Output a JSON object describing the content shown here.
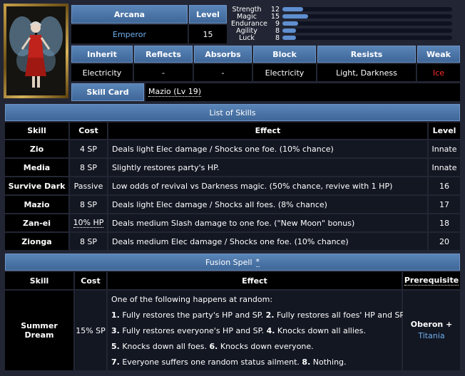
{
  "persona": {
    "arcana_label": "Arcana",
    "arcana_value": "Emperor",
    "level_label": "Level",
    "level_value": "15",
    "portrait_icon": "fairy-persona-portrait-icon"
  },
  "stats": [
    {
      "name": "Strength",
      "value": 12
    },
    {
      "name": "Magic",
      "value": 15
    },
    {
      "name": "Endurance",
      "value": 9
    },
    {
      "name": "Agility",
      "value": 8
    },
    {
      "name": "Luck",
      "value": 8
    }
  ],
  "affinities": {
    "headers": [
      "Inherit",
      "Reflects",
      "Absorbs",
      "Block",
      "Resists",
      "Weak"
    ],
    "values": [
      "Electricity",
      "-",
      "-",
      "Electricity",
      "Light, Darkness",
      "Ice"
    ],
    "weak_color": "#ff2a2a"
  },
  "skill_card": {
    "label": "Skill Card",
    "value": "Mazio (Lv 19)"
  },
  "skills": {
    "title": "List of Skills",
    "columns": [
      "Skill",
      "Cost",
      "Effect",
      "Level"
    ],
    "rows": [
      {
        "skill": "Zio",
        "cost": "4 SP",
        "effect": "Deals light Elec damage / Shocks one foe. (10% chance)",
        "level": "Innate"
      },
      {
        "skill": "Media",
        "cost": "8 SP",
        "effect": "Slightly restores party's HP.",
        "level": "Innate"
      },
      {
        "skill": "Survive Dark",
        "cost": "Passive",
        "effect": "Low odds of revival vs Darkness magic. (50% chance, revive with 1 HP)",
        "level": "16"
      },
      {
        "skill": "Mazio",
        "cost": "8 SP",
        "effect": "Deals light Elec damage / Shocks all foes. (8% chance)",
        "level": "17"
      },
      {
        "skill": "Zan-ei",
        "cost": "10% HP",
        "effect": "Deals medium Slash damage to one foe. (\"New Moon\" bonus)",
        "level": "18"
      },
      {
        "skill": "Zionga",
        "cost": "8 SP",
        "effect": "Deals medium Elec damage / Shocks one foe. (10% chance)",
        "level": "20"
      }
    ]
  },
  "fusion": {
    "title": "Fusion Spell",
    "title_marker": "*",
    "columns": [
      "Skill",
      "Cost",
      "Effect",
      "Prerequisite"
    ],
    "skill": "Summer Dream",
    "cost": "15% SP",
    "intro": "One of the following happens at random:",
    "effects": [
      {
        "n": "1.",
        "text": "Fully restores the party's HP and SP."
      },
      {
        "n": "2.",
        "text": "Fully restores all foes' HP and SP."
      },
      {
        "n": "3.",
        "text": "Fully restores everyone's HP and SP."
      },
      {
        "n": "4.",
        "text": "Knocks down all allies."
      },
      {
        "n": "5.",
        "text": "Knocks down all foes."
      },
      {
        "n": "6.",
        "text": "Knocks down everyone."
      },
      {
        "n": "7.",
        "text": "Everyone suffers one random status ailment."
      },
      {
        "n": "8.",
        "text": "Nothing."
      }
    ],
    "prereq_1": "Oberon +",
    "prereq_2": "Titania"
  },
  "colors": {
    "header_blue": "#4a76aa",
    "link": "#6eb0f0",
    "stat_bar": "#5f8fd0"
  }
}
